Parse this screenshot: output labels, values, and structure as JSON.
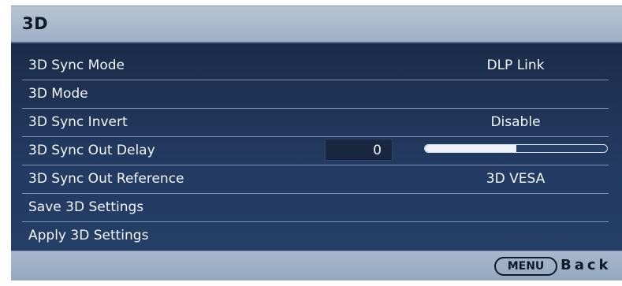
{
  "window": {
    "title": "3D"
  },
  "menu": {
    "items": [
      {
        "label": "3D Sync Mode",
        "value": "DLP Link"
      },
      {
        "label": "3D Mode",
        "value": ""
      },
      {
        "label": "3D Sync Invert",
        "value": "Disable"
      },
      {
        "label": "3D Sync Out Delay",
        "value": "0",
        "slider_level": 0.5
      },
      {
        "label": "3D Sync Out Reference",
        "value": "3D VESA"
      },
      {
        "label": "Save 3D Settings",
        "value": ""
      },
      {
        "label": "Apply 3D Settings",
        "value": ""
      }
    ]
  },
  "footer": {
    "menu_key": "MENU",
    "back_label": "Back"
  },
  "colors": {
    "panel": "#233b62",
    "header": "#b7c4d6",
    "text": "#f2f5fa"
  }
}
